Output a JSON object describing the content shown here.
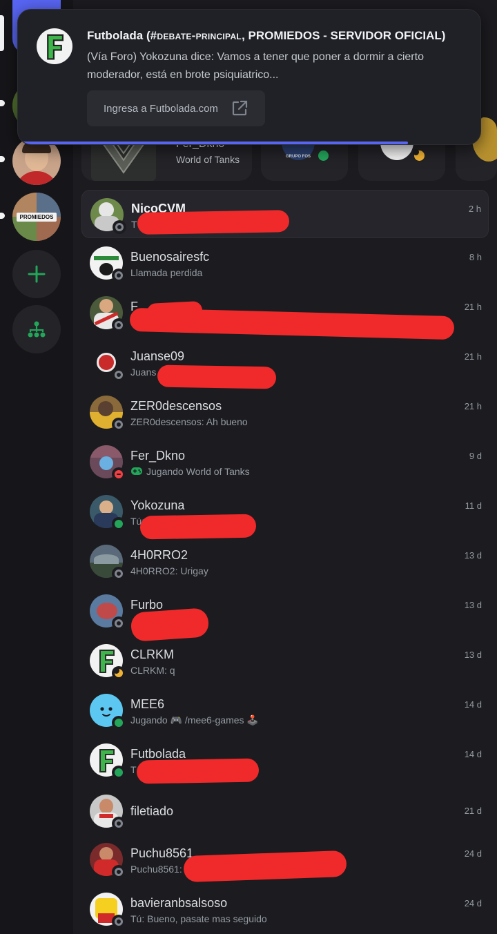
{
  "notification": {
    "server": "Futbolada",
    "channel": "#debate-principal",
    "category": "PROMIEDOS - SERVIDOR OFICIAL",
    "body": "(Vía Foro) Yokozuna dice: Vamos a tener que poner a dormir a cierto moderador, está en brote psiquiatrico...",
    "button_label": "Ingresa a Futbolada.com",
    "icon": "external-link-icon"
  },
  "active_card": {
    "name": "Fer_Dkno",
    "activity": "World of Tanks",
    "group_label": "GRUPO FOS"
  },
  "server_rail": {
    "server_logo_text": "PROMIEDOS",
    "add_icon": "plus-icon",
    "discover_icon": "hub-icon"
  },
  "colors": {
    "accent": "#5865f2",
    "online": "#23a55a",
    "dnd": "#f23f43",
    "idle": "#f0b232",
    "offline": "#80848e",
    "redaction": "#f02a2a"
  },
  "dms": [
    {
      "name": "NicoCVM",
      "sub": "T",
      "time": "2 h",
      "status": "offline",
      "active": true
    },
    {
      "name": "Buenosairesfc",
      "sub": "Llamada perdida",
      "time": "8 h",
      "status": "offline"
    },
    {
      "name": "F",
      "sub": "",
      "time": "21 h",
      "status": "offline"
    },
    {
      "name": "Juanse09",
      "sub": "Juans",
      "time": "21 h",
      "status": "offline"
    },
    {
      "name": "ZER0descensos",
      "sub": "ZER0descensos: Ah bueno",
      "time": "21 h",
      "status": "offline"
    },
    {
      "name": "Fer_Dkno",
      "sub": "Jugando World of Tanks",
      "time": "9 d",
      "status": "dnd",
      "sub_icon": "gamepad-icon"
    },
    {
      "name": "Yokozuna",
      "sub": "Tú: S",
      "time": "11 d",
      "status": "online"
    },
    {
      "name": "4H0RRO2",
      "sub": "4H0RRO2: Urigay",
      "time": "13 d",
      "status": "offline"
    },
    {
      "name": "Furbo",
      "sub": "",
      "time": "13 d",
      "status": "offline"
    },
    {
      "name": "CLRKM",
      "sub": "CLRKM: q",
      "time": "13 d",
      "status": "idle"
    },
    {
      "name": "MEE6",
      "sub": "Jugando 🎮 /mee6-games 🕹️",
      "time": "14 d",
      "status": "online"
    },
    {
      "name": "Futbolada",
      "sub": "T",
      "time": "14 d",
      "status": "online"
    },
    {
      "name": "filetiado",
      "sub": "",
      "time": "21 d",
      "status": "offline"
    },
    {
      "name": "Puchu8561",
      "sub": "Puchu8561:",
      "time": "24 d",
      "status": "offline"
    },
    {
      "name": "bavieranbsalsoso",
      "sub": "Tú: Bueno, pasate mas seguido",
      "time": "24 d",
      "status": "offline"
    }
  ]
}
